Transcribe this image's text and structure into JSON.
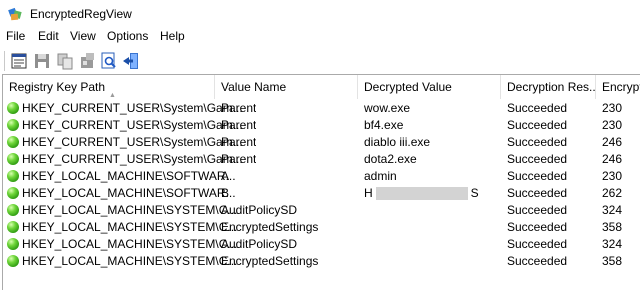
{
  "window": {
    "title": "EncryptedRegView"
  },
  "menu": {
    "items": [
      "File",
      "Edit",
      "View",
      "Options",
      "Help"
    ]
  },
  "toolbar": {
    "buttons": [
      "properties-icon",
      "save-icon",
      "copy-icon",
      "html-report-icon",
      "find-icon",
      "exit-icon"
    ]
  },
  "table": {
    "columns": [
      "Registry Key Path",
      "Value Name",
      "Decrypted Value",
      "Decryption Res...",
      "Encrypt"
    ],
    "rows": [
      {
        "path": "HKEY_CURRENT_USER\\System\\Gam...",
        "name": "Parent",
        "value": "wow.exe",
        "result": "Succeeded",
        "enc": "230"
      },
      {
        "path": "HKEY_CURRENT_USER\\System\\Gam...",
        "name": "Parent",
        "value": "bf4.exe",
        "result": "Succeeded",
        "enc": "230"
      },
      {
        "path": "HKEY_CURRENT_USER\\System\\Gam...",
        "name": "Parent",
        "value": "diablo iii.exe",
        "result": "Succeeded",
        "enc": "246"
      },
      {
        "path": "HKEY_CURRENT_USER\\System\\Gam...",
        "name": "Parent",
        "value": "dota2.exe",
        "result": "Succeeded",
        "enc": "246"
      },
      {
        "path": "HKEY_LOCAL_MACHINE\\SOFTWAR...",
        "name": "A",
        "value": "admin",
        "result": "Succeeded",
        "enc": "230"
      },
      {
        "path": "HKEY_LOCAL_MACHINE\\SOFTWAR...",
        "name": "B",
        "value_prefix": "H",
        "value_suffix": "S",
        "redacted": true,
        "result": "Succeeded",
        "enc": "262"
      },
      {
        "path": "HKEY_LOCAL_MACHINE\\SYSTEM\\C...",
        "name": "AuditPolicySD",
        "value": "",
        "result": "Succeeded",
        "enc": "324"
      },
      {
        "path": "HKEY_LOCAL_MACHINE\\SYSTEM\\C...",
        "name": "EncryptedSettings",
        "value": "",
        "result": "Succeeded",
        "enc": "358"
      },
      {
        "path": "HKEY_LOCAL_MACHINE\\SYSTEM\\C...",
        "name": "AuditPolicySD",
        "value": "",
        "result": "Succeeded",
        "enc": "324"
      },
      {
        "path": "HKEY_LOCAL_MACHINE\\SYSTEM\\C...",
        "name": "EncryptedSettings",
        "value": "",
        "result": "Succeeded",
        "enc": "358"
      }
    ]
  },
  "colors": {
    "status_ok": "#3fae1c",
    "header_border": "#e3e3e3",
    "redaction": "#d3d3d3"
  }
}
